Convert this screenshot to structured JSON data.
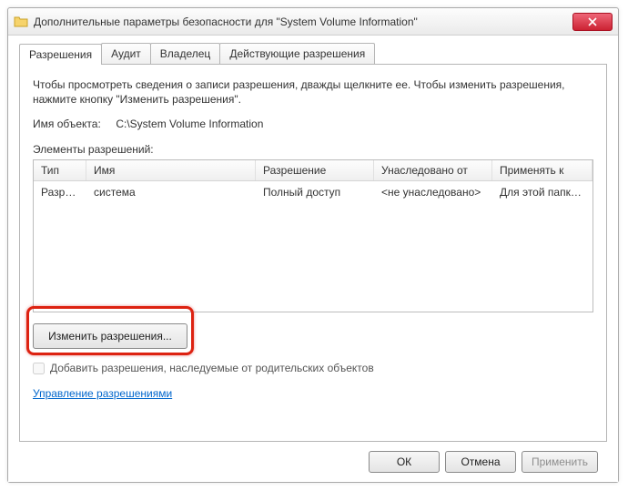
{
  "window": {
    "title": "Дополнительные параметры безопасности для \"System Volume Information\""
  },
  "tabs": {
    "permissions": "Разрешения",
    "audit": "Аудит",
    "owner": "Владелец",
    "effective": "Действующие разрешения"
  },
  "panel": {
    "info": "Чтобы просмотреть сведения о записи разрешения, дважды щелкните ее. Чтобы изменить разрешения, нажмите кнопку \"Изменить разрешения\".",
    "object_label": "Имя объекта:",
    "object_value": "C:\\System Volume Information",
    "elements_label": "Элементы разрешений:",
    "columns": {
      "type": "Тип",
      "name": "Имя",
      "permission": "Разрешение",
      "inherited": "Унаследовано от",
      "apply": "Применять к"
    },
    "rows": [
      {
        "type": "Разреш...",
        "name": "система",
        "permission": "Полный доступ",
        "inherited": "<не унаследовано>",
        "apply": "Для этой папки, ее под..."
      }
    ],
    "change_btn": "Изменить разрешения...",
    "checkbox_label": "Добавить разрешения, наследуемые от родительских объектов",
    "link": "Управление разрешениями"
  },
  "buttons": {
    "ok": "ОК",
    "cancel": "Отмена",
    "apply": "Применить"
  }
}
